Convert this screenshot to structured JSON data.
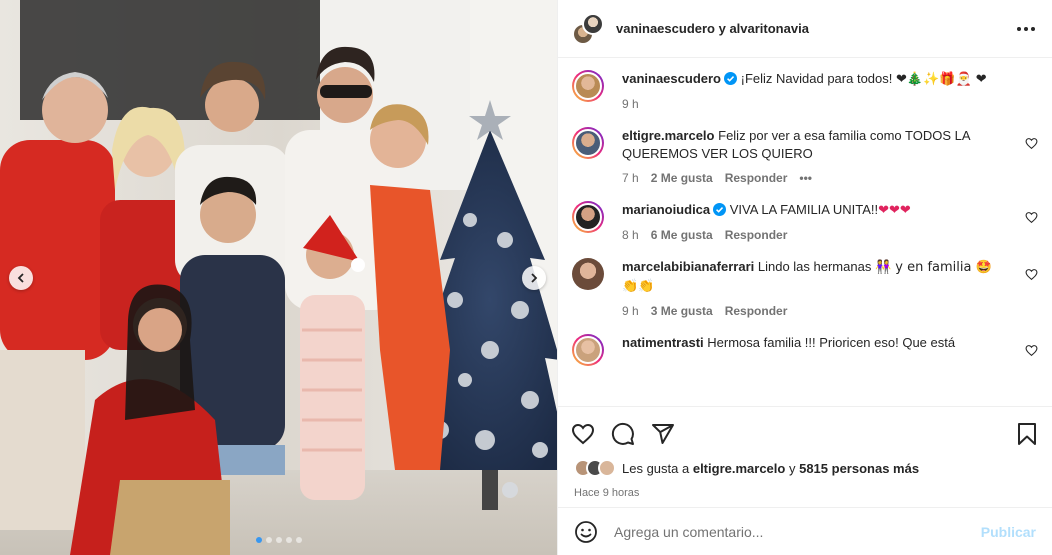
{
  "header": {
    "title": "vaninaescudero y alvaritonavia"
  },
  "carousel": {
    "slide_count": 5,
    "active_index": 0
  },
  "comments": [
    {
      "user": "vaninaescudero",
      "verified": true,
      "text": "¡Feliz Navidad para todos!",
      "emoji": "❤🎄✨🎁🎅 ❤",
      "time": "9 h",
      "likes": "",
      "reply": ""
    },
    {
      "user": "eltigre.marcelo",
      "verified": false,
      "text": "Feliz por ver a esa familia como TODOS LA QUEREMOS VER LOS QUIERO",
      "emoji": "",
      "time": "7 h",
      "likes": "2 Me gusta",
      "reply": "Responder",
      "more": "•••"
    },
    {
      "user": "marianoiudica",
      "verified": true,
      "text": "VIVA LA FAMILIA UNITA!!",
      "emoji": "❤❤❤",
      "time": "8 h",
      "likes": "6 Me gusta",
      "reply": "Responder"
    },
    {
      "user": "marcelabibianaferrari",
      "verified": false,
      "text": "Lindo las hermanas",
      "emoji": "👭 y en familia 🤩 👏👏",
      "time": "9 h",
      "likes": "3 Me gusta",
      "reply": "Responder"
    },
    {
      "user": "natimentrasti",
      "verified": false,
      "text": "Hermosa familia !!! Prioricen eso! Que está",
      "emoji": "",
      "time": "",
      "likes": "",
      "reply": ""
    }
  ],
  "likes": {
    "prefix": "Les gusta a",
    "user": "eltigre.marcelo",
    "joiner": "y",
    "others": "5815 personas más"
  },
  "posted_ago": "Hace 9 horas",
  "add_comment": {
    "placeholder": "Agrega un comentario...",
    "post_label": "Publicar"
  },
  "colors": {
    "link_disabled": "#b2dffc",
    "verified": "#0095f6",
    "muted": "#737373"
  }
}
